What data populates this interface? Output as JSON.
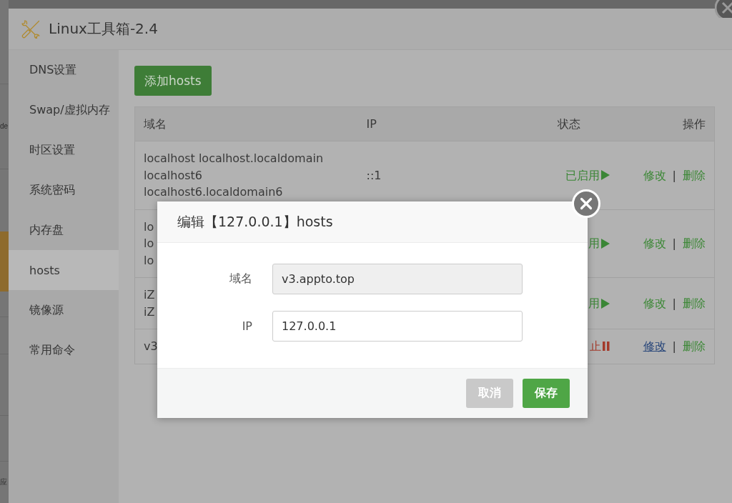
{
  "background_page": {
    "fragments": [
      "de",
      "应"
    ]
  },
  "window": {
    "title": "Linux工具箱-2.4"
  },
  "sidebar": {
    "items": [
      {
        "label": "DNS设置",
        "selected": false
      },
      {
        "label": "Swap/虚拟内存",
        "selected": false
      },
      {
        "label": "时区设置",
        "selected": false
      },
      {
        "label": "系统密码",
        "selected": false
      },
      {
        "label": "内存盘",
        "selected": false
      },
      {
        "label": "hosts",
        "selected": true
      },
      {
        "label": "镜像源",
        "selected": false
      },
      {
        "label": "常用命令",
        "selected": false
      }
    ]
  },
  "toolbar": {
    "add_button": "添加hosts"
  },
  "table": {
    "columns": [
      "域名",
      "IP",
      "状态",
      "操作"
    ],
    "rows": [
      {
        "domain": [
          "localhost localhost.localdomain",
          "localhost6",
          "localhost6.localdomain6"
        ],
        "ip": "::1",
        "status": {
          "text": "已启用",
          "enabled": true
        },
        "actions": {
          "edit": {
            "label": "修改",
            "hovered": false
          },
          "separator": "|",
          "delete": "删除"
        }
      },
      {
        "domain": [
          "lo",
          "lo",
          "lo"
        ],
        "status": {
          "text": "用",
          "enabled": true
        },
        "actions": {
          "edit": {
            "label": "修改",
            "hovered": false
          },
          "separator": "|",
          "delete": "删除"
        }
      },
      {
        "domain": [
          "iZ",
          "iZ"
        ],
        "status": {
          "text": "用",
          "enabled": true
        },
        "actions": {
          "edit": {
            "label": "修改",
            "hovered": false
          },
          "separator": "|",
          "delete": "删除"
        }
      },
      {
        "domain": [
          "v3"
        ],
        "status": {
          "text": "止",
          "enabled": false
        },
        "actions": {
          "edit": {
            "label": "修改",
            "hovered": true
          },
          "separator": "|",
          "delete": "删除"
        }
      }
    ]
  },
  "dialog": {
    "title": "编辑【127.0.0.1】hosts",
    "fields": [
      {
        "label": "域名",
        "value": "v3.appto.top",
        "readonly": true
      },
      {
        "label": "IP",
        "value": "127.0.0.1",
        "readonly": false
      }
    ],
    "buttons": [
      {
        "label": "取消",
        "kind": "secondary"
      },
      {
        "label": "保存",
        "kind": "primary"
      }
    ]
  }
}
